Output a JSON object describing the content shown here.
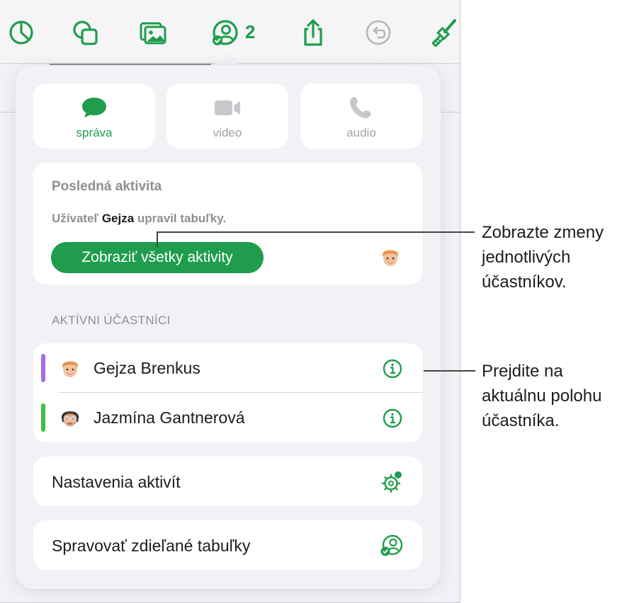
{
  "toolbar": {
    "items": [
      {
        "icon": "chart-icon"
      },
      {
        "icon": "shapes-icon"
      },
      {
        "icon": "media-icon"
      },
      {
        "icon": "collaborate-icon"
      },
      {
        "icon": "share-icon"
      },
      {
        "icon": "undo-icon"
      },
      {
        "icon": "format-brush-icon"
      }
    ],
    "collaborators_count": "2"
  },
  "communication": {
    "message_label": "správa",
    "video_label": "video",
    "audio_label": "audio"
  },
  "recent_activity": {
    "title": "Posledná aktivita",
    "prefix": "Užívateľ ",
    "user": "Gejza",
    "suffix": " upravil tabuľky.",
    "button_label": "Zobraziť všetky aktivity"
  },
  "participants": {
    "caption": "AKTÍVNI ÚČASTNÍCI",
    "items": [
      {
        "name": "Gejza Brenkus",
        "color": "#a46ee6"
      },
      {
        "name": "Jazmína Gantnerová",
        "color": "#3fbf3f"
      }
    ]
  },
  "options": {
    "activity_settings": "Nastavenia aktivít",
    "manage_shared": "Spravovať zdieľané tabuľky"
  },
  "callouts": {
    "first": [
      "Zobrazte zmeny",
      "jednotlivých",
      "účastníkov."
    ],
    "second": [
      "Prejdite na",
      "aktuálnu polohu",
      "účastníka."
    ]
  },
  "colors": {
    "accent": "#1f9d4c",
    "secondary_text": "#8e8e93",
    "popover_bg": "#f2f2f6"
  }
}
